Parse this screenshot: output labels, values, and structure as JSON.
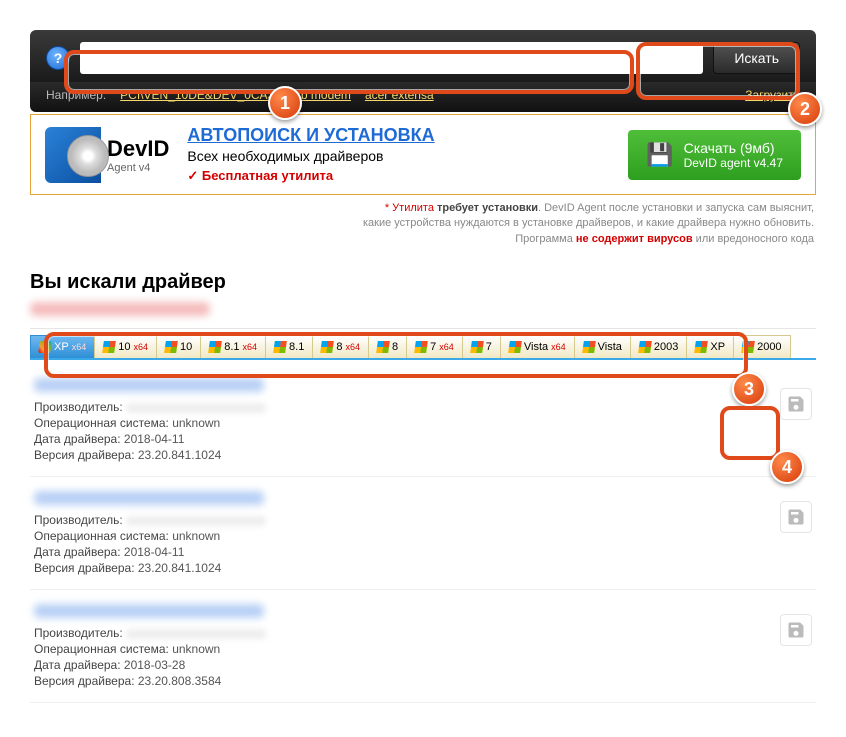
{
  "search": {
    "placeholder": "",
    "button": "Искать",
    "example_label": "Например:",
    "examples": [
      "PCI\\VEN_10DE&DEV_0CA3",
      "usb modem",
      "acer extensa"
    ],
    "upload": "Загрузить"
  },
  "promo": {
    "brand": "DevID",
    "agent": "Agent v4",
    "title": "АВТОПОИСК И УСТАНОВКА",
    "sub": "Всех необходимых драйверов",
    "free": "Бесплатная утилита",
    "dl_l1": "Скачать (9мб)",
    "dl_l2": "DevID agent v4.47"
  },
  "fine": {
    "l1_a": "* Утилита ",
    "l1_b": "требует установки",
    "l1_c": ". DevID Agent после установки и запуска сам выяснит,",
    "l2": "какие устройства нуждаются в установке драйверов, и какие драйвера нужно обновить.",
    "l3_a": "Программа ",
    "l3_b": "не содержит вирусов",
    "l3_c": " или вредоносного кода"
  },
  "heading": "Вы искали драйвер",
  "os_tabs": [
    {
      "label": "XP",
      "x64": true,
      "active": true,
      "flag": "xp"
    },
    {
      "label": "10",
      "x64": true
    },
    {
      "label": "10"
    },
    {
      "label": "8.1",
      "x64": true
    },
    {
      "label": "8.1"
    },
    {
      "label": "8",
      "x64": true
    },
    {
      "label": "8"
    },
    {
      "label": "7",
      "x64": true
    },
    {
      "label": "7"
    },
    {
      "label": "Vista",
      "x64": true
    },
    {
      "label": "Vista"
    },
    {
      "label": "2003"
    },
    {
      "label": "XP"
    },
    {
      "label": "2000"
    }
  ],
  "labels": {
    "manufacturer": "Производитель:",
    "os": "Операционная система:",
    "date": "Дата драйвера:",
    "version": "Версия драйвера:"
  },
  "results": [
    {
      "os": "unknown",
      "date": "2018-04-11",
      "version": "23.20.841.1024"
    },
    {
      "os": "unknown",
      "date": "2018-04-11",
      "version": "23.20.841.1024"
    },
    {
      "os": "unknown",
      "date": "2018-03-28",
      "version": "23.20.808.3584"
    }
  ],
  "callouts": {
    "1": "1",
    "2": "2",
    "3": "3",
    "4": "4"
  }
}
